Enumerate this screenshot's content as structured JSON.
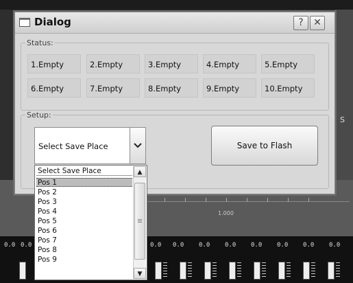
{
  "dialog": {
    "title": "Dialog",
    "help_label": "?",
    "close_label": "✕",
    "status_group_label": "Status:",
    "setup_group_label": "Setup:",
    "status_slots": [
      "1.Empty",
      "2.Empty",
      "3.Empty",
      "4.Empty",
      "5.Empty",
      "6.Empty",
      "7.Empty",
      "8.Empty",
      "9.Empty",
      "10.Empty"
    ],
    "save_place_select": {
      "value": "Select Save Place"
    },
    "save_button_label": "Save to Flash"
  },
  "dropdown": {
    "options": [
      "Select Save Place",
      "Pos 1",
      "Pos 2",
      "Pos 3",
      "Pos 4",
      "Pos 5",
      "Pos 6",
      "Pos 7",
      "Pos 8",
      "Pos 9"
    ],
    "highlighted": "Pos 1"
  },
  "background_app": {
    "ruler_label": "1.000",
    "side_letter": "S",
    "meter_values": [
      "0.0",
      "0.0",
      "0.0",
      "0.0",
      "0.0",
      "0.0",
      "0.0",
      "0.0",
      "0.0",
      "0.0",
      "0.0"
    ]
  }
}
